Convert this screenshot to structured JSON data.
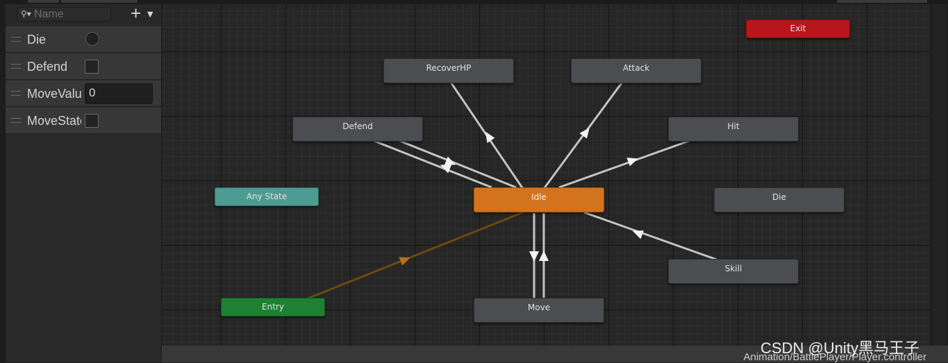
{
  "parameters_panel": {
    "search_placeholder": "Name",
    "add_button_icon": "plus-icon",
    "params": [
      {
        "name": "Die",
        "type": "trigger"
      },
      {
        "name": "Defend",
        "type": "bool",
        "value": false
      },
      {
        "name": "MoveValue",
        "type": "float",
        "value": "0"
      },
      {
        "name": "MoveState",
        "type": "bool",
        "value": false
      }
    ]
  },
  "graph": {
    "states": {
      "exit": "Exit",
      "recover_hp": "RecoverHP",
      "attack": "Attack",
      "defend": "Defend",
      "hit": "Hit",
      "any_state": "Any State",
      "idle": "Idle",
      "die": "Die",
      "skill": "Skill",
      "entry": "Entry",
      "move": "Move"
    },
    "colors": {
      "default_state": "#4b4d51",
      "default_state_active": "#d3731e",
      "any_state": "#4d9b92",
      "entry": "#1d8131",
      "exit": "#b8161d",
      "transition": "#c8c8c8",
      "entry_transition": "#6b4a10"
    }
  },
  "status_bar": {
    "asset_path": "Animation/BattlePlayer/Player.controller"
  },
  "watermark": "CSDN @Unity黑马王子"
}
